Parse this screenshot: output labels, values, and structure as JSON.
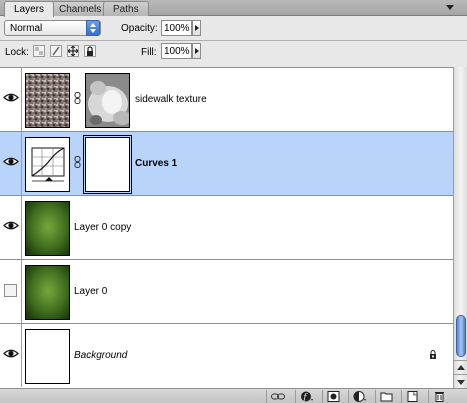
{
  "tabs": [
    {
      "label": "Layers",
      "active": true
    },
    {
      "label": "Channels",
      "active": false
    },
    {
      "label": "Paths",
      "active": false
    }
  ],
  "blend_mode": {
    "selected": "Normal"
  },
  "opacity": {
    "label": "Opacity:",
    "value": "100%"
  },
  "lock": {
    "label": "Lock:",
    "icons": [
      "lock-transparent-icon",
      "lock-brush-icon",
      "lock-move-icon",
      "lock-all-icon"
    ]
  },
  "fill": {
    "label": "Fill:",
    "value": "100%"
  },
  "layers": [
    {
      "name": "sidewalk texture",
      "visible": true,
      "has_mask": true,
      "selected": false,
      "style": "normal",
      "thumb": "texture"
    },
    {
      "name": "Curves 1",
      "visible": true,
      "has_mask": true,
      "selected": true,
      "style": "bold",
      "thumb": "curves"
    },
    {
      "name": "Layer 0 copy",
      "visible": true,
      "has_mask": false,
      "selected": false,
      "style": "normal",
      "thumb": "green"
    },
    {
      "name": "Layer 0",
      "visible": false,
      "has_mask": false,
      "selected": false,
      "style": "normal",
      "thumb": "green"
    },
    {
      "name": "Background",
      "visible": true,
      "has_mask": false,
      "selected": false,
      "style": "italic",
      "thumb": "white",
      "locked": true
    }
  ],
  "bottom_buttons": [
    "link-layers-icon",
    "layer-style-icon",
    "add-mask-icon",
    "new-adjustment-layer-icon",
    "new-group-icon",
    "new-layer-icon",
    "delete-layer-icon"
  ],
  "colors": {
    "selection": "#b8d4fb",
    "accent": "#2f6fd0"
  }
}
